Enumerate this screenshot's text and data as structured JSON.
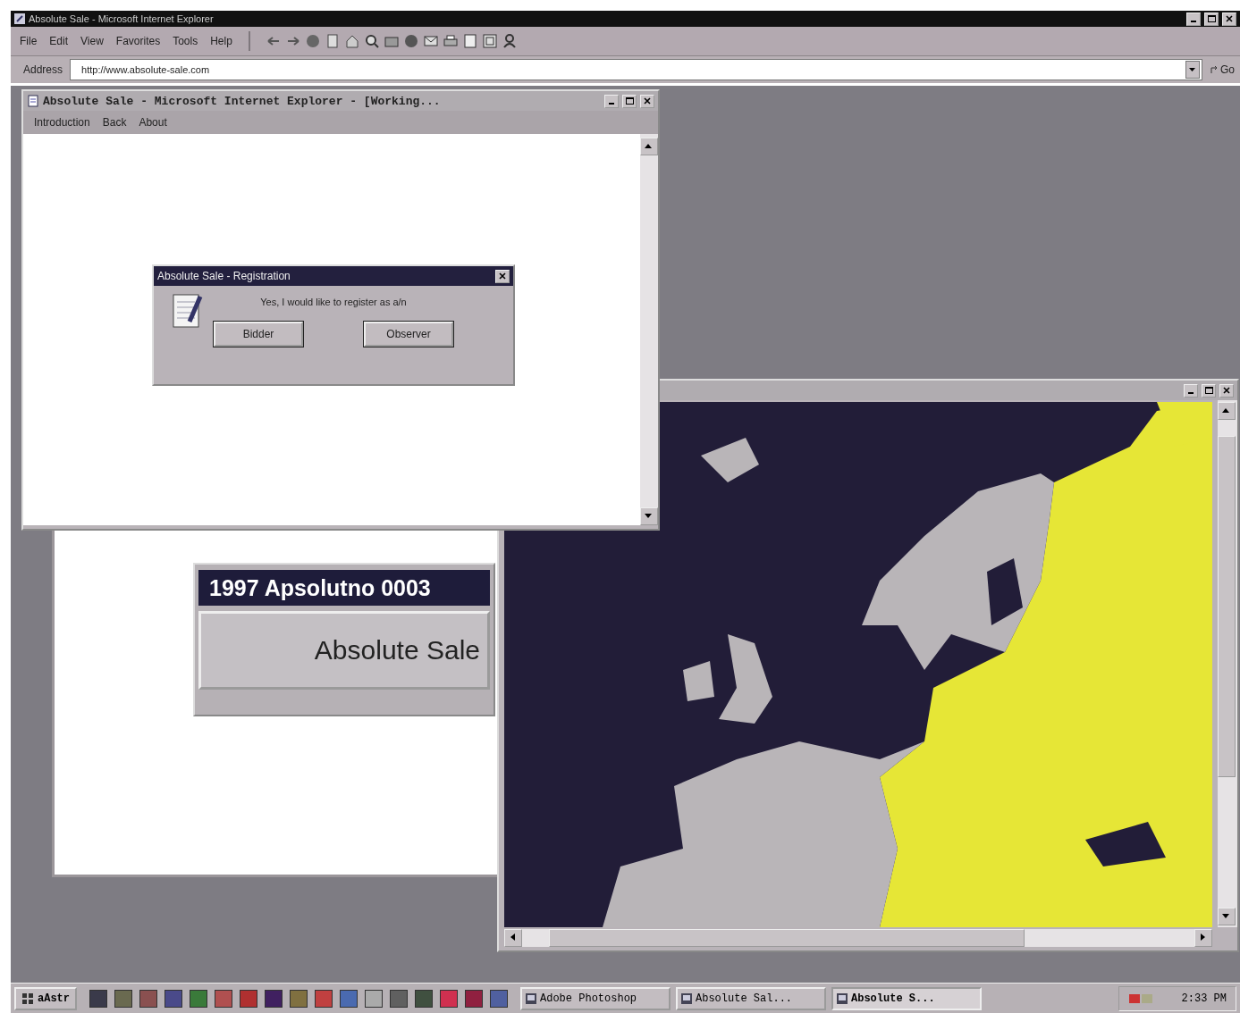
{
  "browser": {
    "title": "Absolute Sale - Microsoft Internet Explorer",
    "menu": [
      "File",
      "Edit",
      "View",
      "Favorites",
      "Tools",
      "Help"
    ],
    "address_label": "Address",
    "address": "http://www.absolute-sale.com",
    "go": "Go"
  },
  "site_window": {
    "title": "Absolute Sale - Microsoft Internet Explorer - [Working...",
    "menu": [
      "Introduction",
      "Back",
      "About"
    ]
  },
  "dialog": {
    "title": "Absolute Sale - Registration",
    "message": "Yes, I would like to register as a/n",
    "buttons": [
      "Bidder",
      "Observer"
    ]
  },
  "splash": {
    "title": "1997 Apsolutno 0003",
    "button": "Absolute Sale"
  },
  "taskbar": {
    "start": "aAstr",
    "tasks": [
      {
        "label": "Adobe Photoshop",
        "selected": false
      },
      {
        "label": "Absolute Sal...",
        "selected": false
      },
      {
        "label": "Absolute S...",
        "selected": true
      }
    ],
    "clock": "2:33 PM"
  }
}
